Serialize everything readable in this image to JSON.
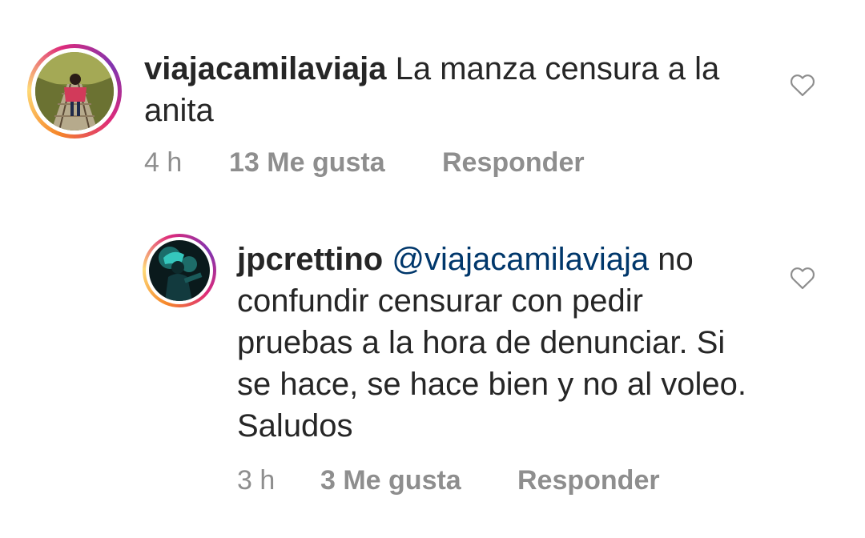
{
  "comments": [
    {
      "username": "viajacamilaviaja",
      "text": "La manza censura a la anita",
      "time": "4 h",
      "likes": "13 Me gusta",
      "reply": "Responder",
      "like_icon": "heart-outline-icon"
    }
  ],
  "replies": [
    {
      "username": "jpcrettino",
      "mention": "@viajacamilaviaja",
      "text": "no confundir censurar con pedir pruebas a la hora de denunciar. Si se hace, se hace bien y no al voleo. Saludos",
      "time": "3 h",
      "likes": "3 Me gusta",
      "reply": "Responder",
      "like_icon": "heart-outline-icon"
    }
  ]
}
